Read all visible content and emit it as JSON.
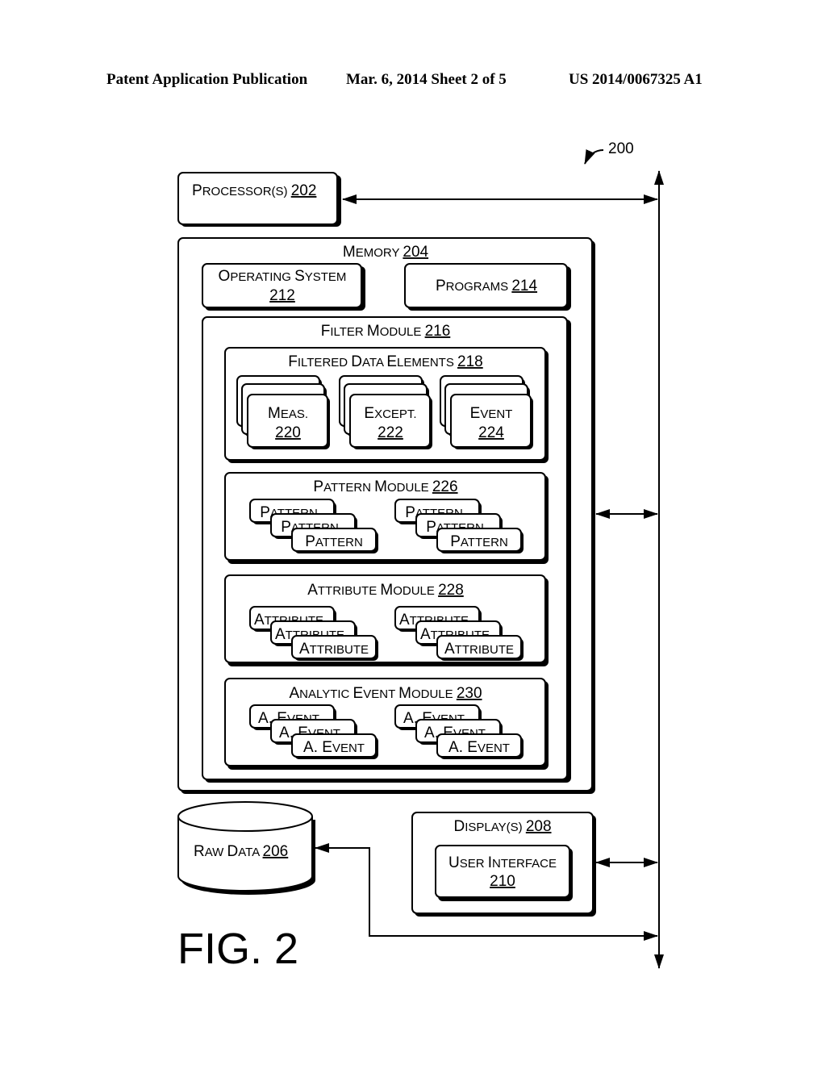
{
  "header": {
    "publication": "Patent Application Publication",
    "date_sheet": "Mar. 6, 2014   Sheet 2 of 5",
    "number": "US 2014/0067325 A1"
  },
  "figure": {
    "ref": "200",
    "caption": "FIG. 2"
  },
  "processor": {
    "big": "P",
    "small": "ROCESSOR(S) ",
    "ref": "202"
  },
  "memory": {
    "big": "M",
    "small": "EMORY ",
    "ref": "204"
  },
  "operating_system": {
    "line1_big1": "O",
    "line1_small1": "PERATING ",
    "line1_big2": "S",
    "line1_small2": "YSTEM",
    "ref": "212"
  },
  "programs": {
    "big": "P",
    "small": "ROGRAMS ",
    "ref": "214"
  },
  "filter_module": {
    "big1": "F",
    "small1": "ILTER ",
    "big2": "M",
    "small2": "ODULE ",
    "ref": "216"
  },
  "filtered_data_elements": {
    "big1": "F",
    "small1": "ILTERED ",
    "big2": "D",
    "small2": "ATA ",
    "big3": "E",
    "small3": "LEMENTS ",
    "ref": "218",
    "items": [
      {
        "big": "M",
        "small": "EAS.",
        "ref": "220"
      },
      {
        "big": "E",
        "small": "XCEPT.",
        "ref": "222"
      },
      {
        "big": "E",
        "small": "VENT",
        "ref": "224"
      }
    ]
  },
  "pattern_module": {
    "big1": "P",
    "small1": "ATTERN ",
    "big2": "M",
    "small2": "ODULE ",
    "ref": "226",
    "item_big": "P",
    "item_small": "ATTERN"
  },
  "attribute_module": {
    "big1": "A",
    "small1": "TTRIBUTE ",
    "big2": "M",
    "small2": "ODULE ",
    "ref": "228",
    "item_big": "A",
    "item_small": "TTRIBUTE"
  },
  "analytic_event_module": {
    "big1": "A",
    "small1": "NALYTIC ",
    "big2": "E",
    "small2": "VENT ",
    "big3": "M",
    "small3": "ODULE ",
    "ref": "230",
    "item_big": "A. E",
    "item_small": "VENT"
  },
  "raw_data": {
    "big1": "R",
    "small1": "AW ",
    "big2": "D",
    "small2": "ATA ",
    "ref": "206"
  },
  "displays": {
    "big": "D",
    "small": "ISPLAY(S) ",
    "ref": "208"
  },
  "user_interface": {
    "big1": "U",
    "small1": "SER ",
    "big2": "I",
    "small2": "NTERFACE",
    "ref": "210"
  }
}
